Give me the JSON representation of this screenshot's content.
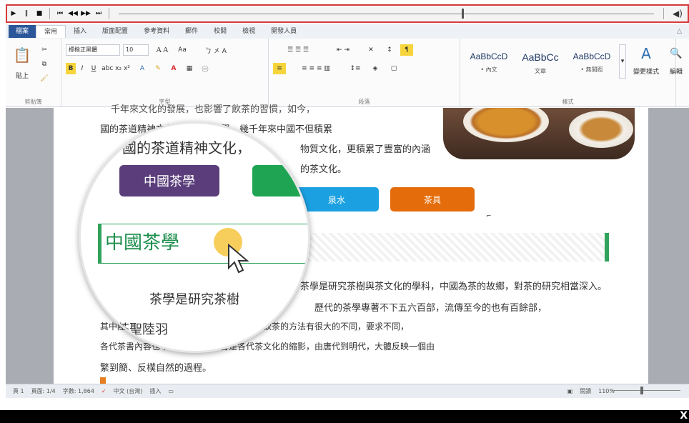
{
  "player": {
    "controls": [
      "▶",
      "‖",
      "■",
      "⏮",
      "◀◀",
      "▶▶",
      "⏭"
    ],
    "volume_icon": "speaker-icon",
    "volume_text": "◀)"
  },
  "ribbon": {
    "tabs": [
      "檔案",
      "常用",
      "插入",
      "版面配置",
      "參考資料",
      "郵件",
      "校閱",
      "檢視",
      "開發人員"
    ],
    "font_name": "標楷正黑體",
    "font_size": "10",
    "groups": [
      "剪貼簿",
      "字型",
      "段落",
      "樣式"
    ],
    "paste_label": "貼上",
    "styles": [
      {
        "sample": "AaBbCcD",
        "name": "• 內文"
      },
      {
        "sample": "AaBbCc",
        "name": "文章"
      },
      {
        "sample": "AaBbCcD",
        "name": "• 無間距"
      }
    ],
    "change_styles": "變更樣式",
    "editing": "編輯"
  },
  "document": {
    "top_line1": "千年來文化的發展，也影響了飲茶的習慣，如今，",
    "top_line2": "國的茶道精神文化，宗教、哲學，幾千年來中國不但積累",
    "top_line3": "物質文化，更積累了豐富的內涵",
    "top_line4": "的茶文化。",
    "pills": [
      "中國茶學",
      "泉水",
      "茶具"
    ],
    "heading": "中國茶學",
    "body1": "茶學是研究茶樹與茶文化的學科，中國為茶的故鄉，對茶的研究相當深入。",
    "body2": "歷代的茶學專著不下五六百部，流傳至今的也有百餘部，",
    "body3": "其中陸羽的茶經更為重要，中國各代飲茶、飲茶的方法有很大的不同，要求不同，",
    "body4": "各代茶書內容也不相同，各代茶書是各代茶文化的縮影，由唐代到明代，大體反映一個由",
    "body5": "繁到簡、反樸自然的過程。"
  },
  "lens": {
    "line1": "國的茶道精神文化，",
    "pill": "中國茶學",
    "heading": "中國茶學",
    "line2": "茶學是研究茶樹",
    "line3": "歷代茶聖陸羽"
  },
  "status": {
    "page": "頁 1",
    "section": "頁面: 1/4",
    "words": "字數: 1,864",
    "lang": "中文 (台灣)",
    "mode": "插入",
    "view": "閱讀",
    "zoom": "110%"
  },
  "colors": {
    "purple": "#5a3d7a",
    "green": "#1ea453",
    "blue": "#1ba1e2",
    "orange": "#e46c0a"
  }
}
